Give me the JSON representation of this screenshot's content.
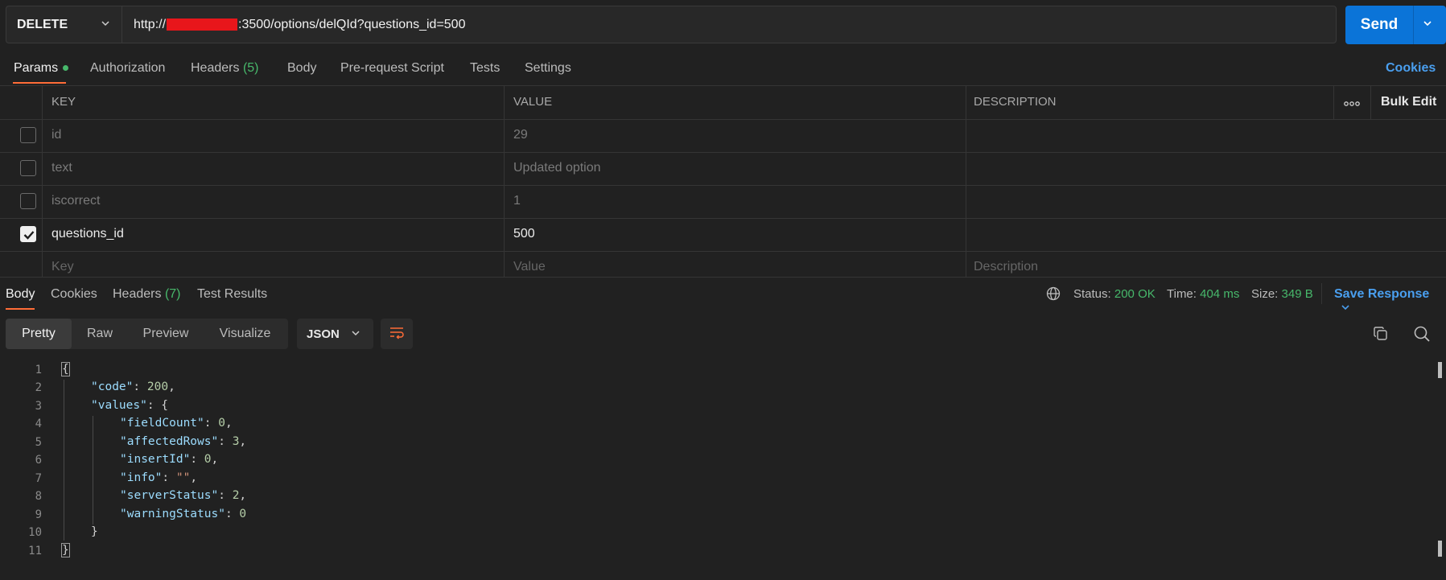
{
  "request": {
    "method": "DELETE",
    "url_prefix": "http://",
    "url_suffix": ":3500/options/delQId?questions_id=500",
    "send_label": "Send"
  },
  "request_tabs": {
    "params": "Params",
    "authorization": "Authorization",
    "headers": "Headers",
    "headers_count": "(5)",
    "body": "Body",
    "prerequest": "Pre-request Script",
    "tests": "Tests",
    "settings": "Settings",
    "cookies": "Cookies"
  },
  "params_table": {
    "headers": {
      "key": "KEY",
      "value": "VALUE",
      "description": "DESCRIPTION",
      "bulk_edit": "Bulk Edit"
    },
    "rows": [
      {
        "key": "id",
        "value": "29",
        "checked": false
      },
      {
        "key": "text",
        "value": "Updated option",
        "checked": false
      },
      {
        "key": "iscorrect",
        "value": "1",
        "checked": false
      },
      {
        "key": "questions_id",
        "value": "500",
        "checked": true
      }
    ],
    "placeholders": {
      "key": "Key",
      "value": "Value",
      "description": "Description"
    }
  },
  "response_tabs": {
    "body": "Body",
    "cookies": "Cookies",
    "headers": "Headers",
    "headers_count": "(7)",
    "test_results": "Test Results"
  },
  "response_status": {
    "status_label": "Status:",
    "status_value": "200 OK",
    "time_label": "Time:",
    "time_value": "404 ms",
    "size_label": "Size:",
    "size_value": "349 B",
    "save_response": "Save Response"
  },
  "view_modes": {
    "pretty": "Pretty",
    "raw": "Raw",
    "preview": "Preview",
    "visualize": "Visualize",
    "format": "JSON"
  },
  "response_body": {
    "code": 200,
    "fieldCount": 0,
    "affectedRows": 3,
    "insertId": 0,
    "info": "",
    "serverStatus": 2,
    "warningStatus": 0
  },
  "colors": {
    "accent_orange": "#ff6c37",
    "send_blue": "#0b74d8",
    "link_blue": "#4a9fef",
    "status_green": "#47b86b"
  },
  "icons": [
    "chevron-down-icon",
    "more-dots-icon",
    "checkbox-icon",
    "globe-icon",
    "wrap-lines-icon",
    "copy-icon",
    "search-icon"
  ]
}
